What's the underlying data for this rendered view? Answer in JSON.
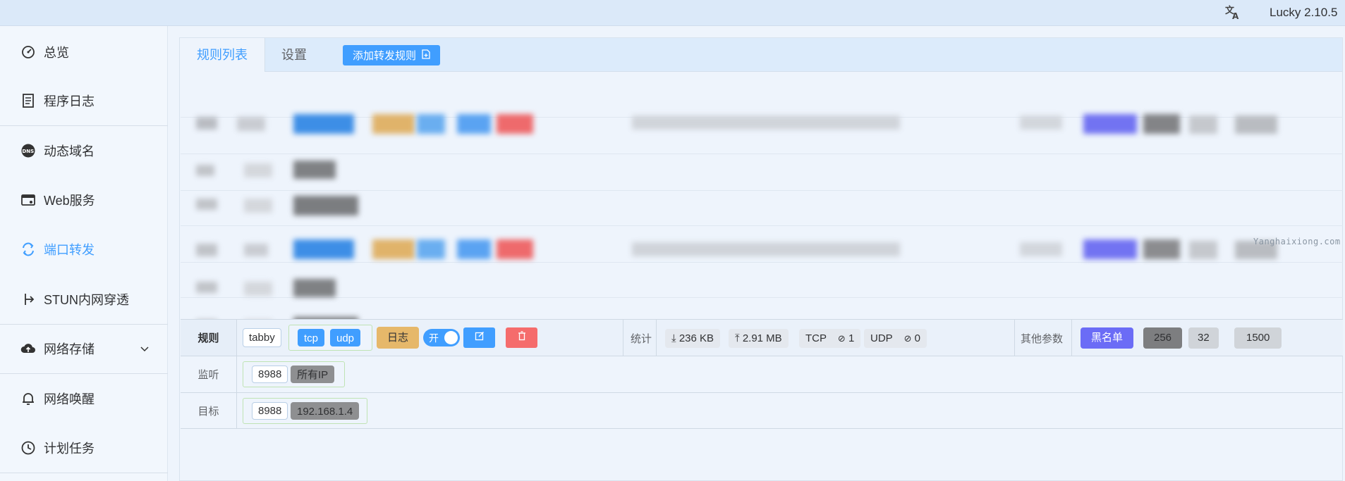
{
  "topbar": {
    "translate_icon": "translate-icon",
    "version": "Lucky 2.10.5"
  },
  "sidebar": {
    "items": [
      {
        "label": "总览",
        "icon": "dashboard-icon"
      },
      {
        "label": "程序日志",
        "icon": "log-icon"
      },
      {
        "label": "动态域名",
        "icon": "dns-icon"
      },
      {
        "label": "Web服务",
        "icon": "web-icon"
      },
      {
        "label": "端口转发",
        "icon": "port-forward-icon"
      },
      {
        "label": "STUN内网穿透",
        "icon": "stun-icon"
      },
      {
        "label": "网络存储",
        "icon": "cloud-upload-icon"
      },
      {
        "label": "网络唤醒",
        "icon": "bell-icon"
      },
      {
        "label": "计划任务",
        "icon": "clock-icon"
      }
    ],
    "active_index": 4
  },
  "tabs": [
    {
      "label": "规则列表"
    },
    {
      "label": "设置"
    }
  ],
  "add_button": {
    "label": "添加转发规则"
  },
  "watermark": "Yanghaixiong.com",
  "rule": {
    "row1_label": "规则",
    "name": "tabby",
    "protocols": [
      "tcp",
      "udp"
    ],
    "log_label": "日志",
    "switch_label": "开",
    "stats_label": "统计",
    "download": "236 KB",
    "upload": "2.91 MB",
    "tcp_label": "TCP",
    "tcp_count": "1",
    "udp_label": "UDP",
    "udp_count": "0",
    "other_label": "其他参数",
    "blacklist": "黑名单",
    "param1": "256",
    "param2": "32",
    "param3": "1500",
    "listen_label": "监听",
    "listen_port": "8988",
    "listen_ip": "所有IP",
    "target_label": "目标",
    "target_port": "8988",
    "target_ip": "192.168.1.4"
  },
  "colors": {
    "accent": "#409eff",
    "danger": "#f56c6c",
    "warning": "#e6b86a",
    "purple": "#6b6cf6"
  }
}
